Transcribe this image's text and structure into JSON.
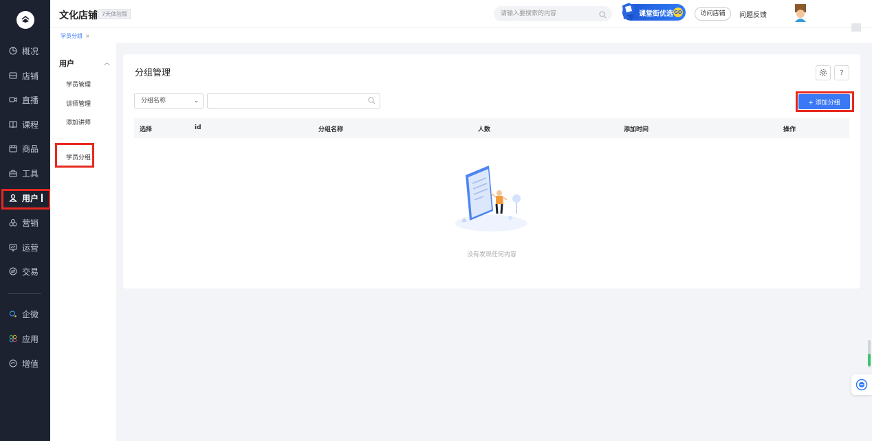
{
  "nav": {
    "items": [
      {
        "label": "概况",
        "icon": "chart-pie-icon"
      },
      {
        "label": "店铺",
        "icon": "store-icon"
      },
      {
        "label": "直播",
        "icon": "video-icon"
      },
      {
        "label": "课程",
        "icon": "book-icon"
      },
      {
        "label": "商品",
        "icon": "goods-icon"
      },
      {
        "label": "工具",
        "icon": "toolbox-icon"
      },
      {
        "label": "用户",
        "icon": "user-icon"
      },
      {
        "label": "营销",
        "icon": "marketing-icon"
      },
      {
        "label": "运营",
        "icon": "monitor-icon"
      },
      {
        "label": "交易",
        "icon": "exchange-icon"
      },
      {
        "label": "企微",
        "icon": "wecom-icon"
      },
      {
        "label": "应用",
        "icon": "apps-icon"
      },
      {
        "label": "增值",
        "icon": "addon-icon"
      }
    ],
    "active": "用户"
  },
  "header": {
    "shop_name": "文化店铺",
    "trial_tag": "7天体验版",
    "search_placeholder": "请输入要搜索的内容",
    "promo_label": "课堂街优选",
    "promo_go": "GO",
    "visit_label": "访问店铺",
    "feedback_label": "问题反馈"
  },
  "tabs": [
    {
      "label": "学员分组",
      "close": "×"
    }
  ],
  "submenu": {
    "title": "用户",
    "items": [
      "学员管理",
      "讲师管理",
      "添加讲师",
      "学员分组"
    ],
    "active": "学员分组"
  },
  "main": {
    "title": "分组管理",
    "settings_icon": "gear-icon",
    "help_label": "?",
    "filter_select": "分组名称",
    "add_button": "+ 添加分组",
    "columns": [
      "选择",
      "id",
      "分组名称",
      "人数",
      "添加时间",
      "操作"
    ],
    "empty_text": "没有发现任何内容"
  },
  "colors": {
    "accent": "#3a78f5",
    "nav_bg": "#1c2230",
    "highlight": "#e8281e"
  }
}
